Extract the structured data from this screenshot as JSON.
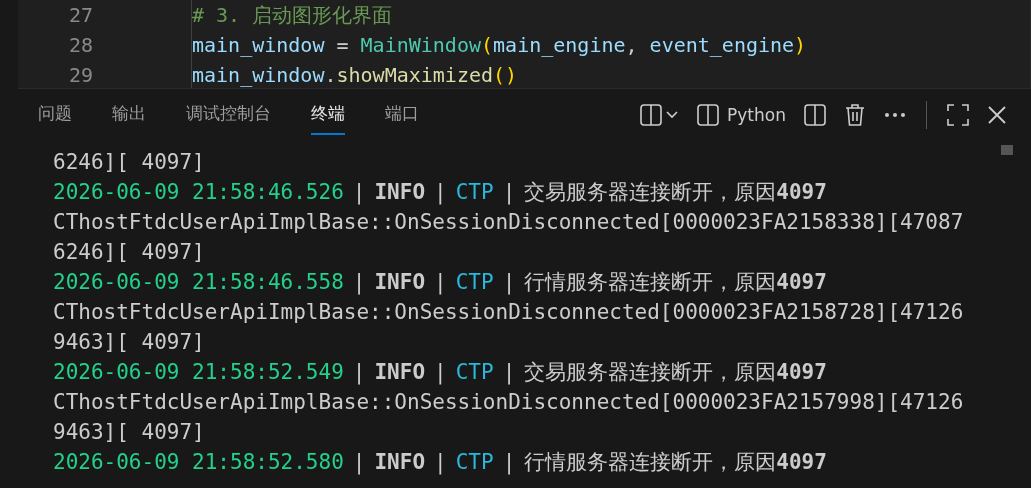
{
  "editor": {
    "lines": [
      {
        "number": "27",
        "tokens": [
          {
            "kind": "comment",
            "text": "# 3. 启动图形化界面"
          }
        ]
      },
      {
        "number": "28",
        "tokens": [
          {
            "kind": "var",
            "text": "main_window"
          },
          {
            "kind": "plain",
            "text": " = "
          },
          {
            "kind": "class",
            "text": "MainWindow"
          },
          {
            "kind": "paren",
            "text": "("
          },
          {
            "kind": "var",
            "text": "main_engine"
          },
          {
            "kind": "plain",
            "text": ", "
          },
          {
            "kind": "var",
            "text": "event_engine"
          },
          {
            "kind": "paren",
            "text": ")"
          }
        ]
      },
      {
        "number": "29",
        "tokens": [
          {
            "kind": "var",
            "text": "main_window"
          },
          {
            "kind": "plain",
            "text": "."
          },
          {
            "kind": "func",
            "text": "showMaximized"
          },
          {
            "kind": "paren",
            "text": "()"
          }
        ]
      }
    ]
  },
  "panel": {
    "tabs": [
      {
        "label": "问题",
        "selected": false
      },
      {
        "label": "输出",
        "selected": false
      },
      {
        "label": "调试控制台",
        "selected": false
      },
      {
        "label": "终端",
        "selected": true
      },
      {
        "label": "端口",
        "selected": false
      }
    ],
    "terminal_name": "Python",
    "lines": [
      {
        "kind": "plain",
        "text": "6246][ 4097]"
      },
      {
        "kind": "log",
        "parts": [
          {
            "kind": "time",
            "text": "2026-06-09 21:58:46.526"
          },
          {
            "kind": "sep",
            "text": "|"
          },
          {
            "kind": "level",
            "text": "INFO"
          },
          {
            "kind": "sep",
            "text": "|"
          },
          {
            "kind": "source",
            "text": "CTP"
          },
          {
            "kind": "sep",
            "text": "|"
          },
          {
            "kind": "message",
            "text": "交易服务器连接断开，原因**4097**"
          }
        ]
      },
      {
        "kind": "plain",
        "text": "CThostFtdcUserApiImplBase::OnSessionDisconnected[0000023FA2158338][47087"
      },
      {
        "kind": "plain",
        "text": "6246][ 4097]"
      },
      {
        "kind": "log",
        "parts": [
          {
            "kind": "time",
            "text": "2026-06-09 21:58:46.558"
          },
          {
            "kind": "sep",
            "text": "|"
          },
          {
            "kind": "level",
            "text": "INFO"
          },
          {
            "kind": "sep",
            "text": "|"
          },
          {
            "kind": "source",
            "text": "CTP"
          },
          {
            "kind": "sep",
            "text": "|"
          },
          {
            "kind": "message",
            "text": "行情服务器连接断开，原因**4097**"
          }
        ]
      },
      {
        "kind": "plain",
        "text": "CThostFtdcUserApiImplBase::OnSessionDisconnected[0000023FA2158728][47126"
      },
      {
        "kind": "plain",
        "text": "9463][ 4097]"
      },
      {
        "kind": "log",
        "parts": [
          {
            "kind": "time",
            "text": "2026-06-09 21:58:52.549"
          },
          {
            "kind": "sep",
            "text": "|"
          },
          {
            "kind": "level",
            "text": "INFO"
          },
          {
            "kind": "sep",
            "text": "|"
          },
          {
            "kind": "source",
            "text": "CTP"
          },
          {
            "kind": "sep",
            "text": "|"
          },
          {
            "kind": "message",
            "text": "交易服务器连接断开，原因**4097**"
          }
        ]
      },
      {
        "kind": "plain",
        "text": "CThostFtdcUserApiImplBase::OnSessionDisconnected[0000023FA2157998][47126"
      },
      {
        "kind": "plain",
        "text": "9463][ 4097]"
      },
      {
        "kind": "log",
        "parts": [
          {
            "kind": "time",
            "text": "2026-06-09 21:58:52.580"
          },
          {
            "kind": "sep",
            "text": "|"
          },
          {
            "kind": "level",
            "text": "INFO"
          },
          {
            "kind": "sep",
            "text": "|"
          },
          {
            "kind": "source",
            "text": "CTP"
          },
          {
            "kind": "sep",
            "text": "|"
          },
          {
            "kind": "message",
            "text": "行情服务器连接断开，原因**4097**"
          }
        ]
      }
    ]
  }
}
